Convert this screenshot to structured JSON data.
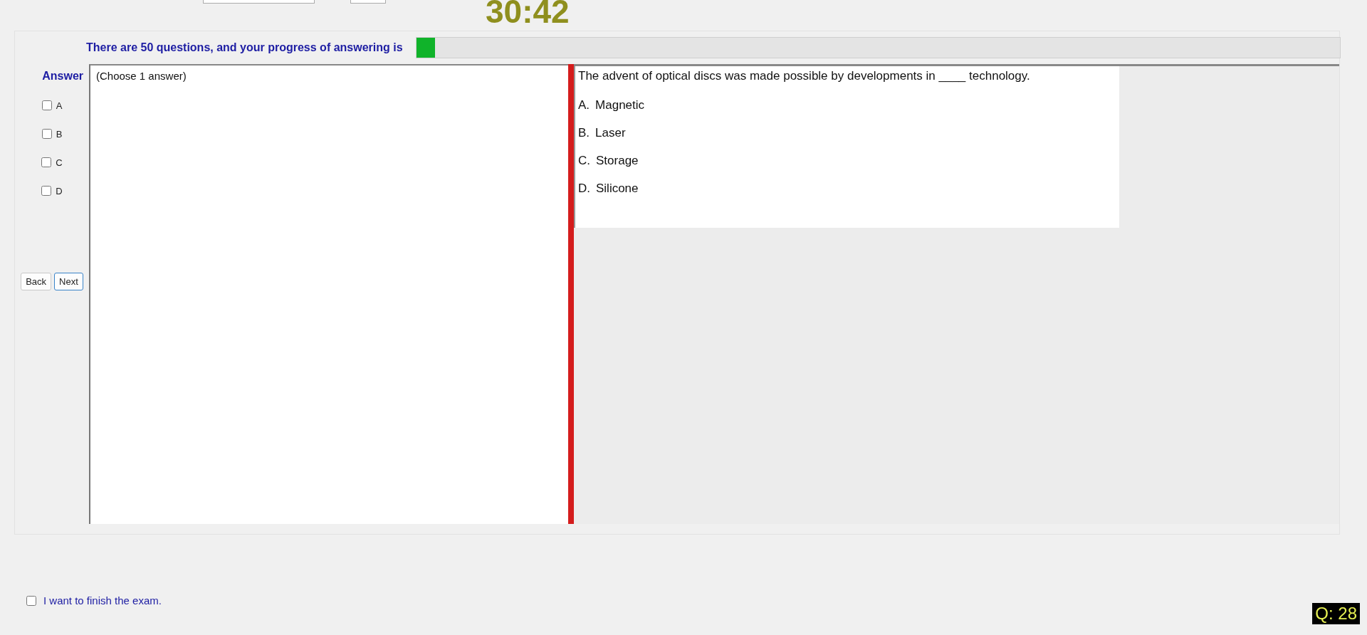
{
  "timer": "30:42",
  "progress": {
    "text": "There are 50 questions, and your progress of answering is",
    "level": 0.02
  },
  "answer_panel": {
    "title": "Answer",
    "options": [
      {
        "label": "A",
        "checked": false
      },
      {
        "label": "B",
        "checked": false
      },
      {
        "label": "C",
        "checked": false
      },
      {
        "label": "D",
        "checked": false
      }
    ],
    "buttons": [
      {
        "label": "Back",
        "selected": false
      },
      {
        "label": "Next",
        "selected": true
      }
    ]
  },
  "answer_hint": "(Choose 1 answer)",
  "question": {
    "text": "The advent of optical discs was made possible by developments in ____ technology.",
    "choices": [
      {
        "letter": "A.",
        "text": "Magnetic"
      },
      {
        "letter": "B.",
        "text": "Laser"
      },
      {
        "letter": "C.",
        "text": "Storage"
      },
      {
        "letter": "D.",
        "text": "Silicone"
      }
    ]
  },
  "finish": {
    "label": "I want to finish the exam.",
    "checked": false
  },
  "question_number": "Q: 28"
}
